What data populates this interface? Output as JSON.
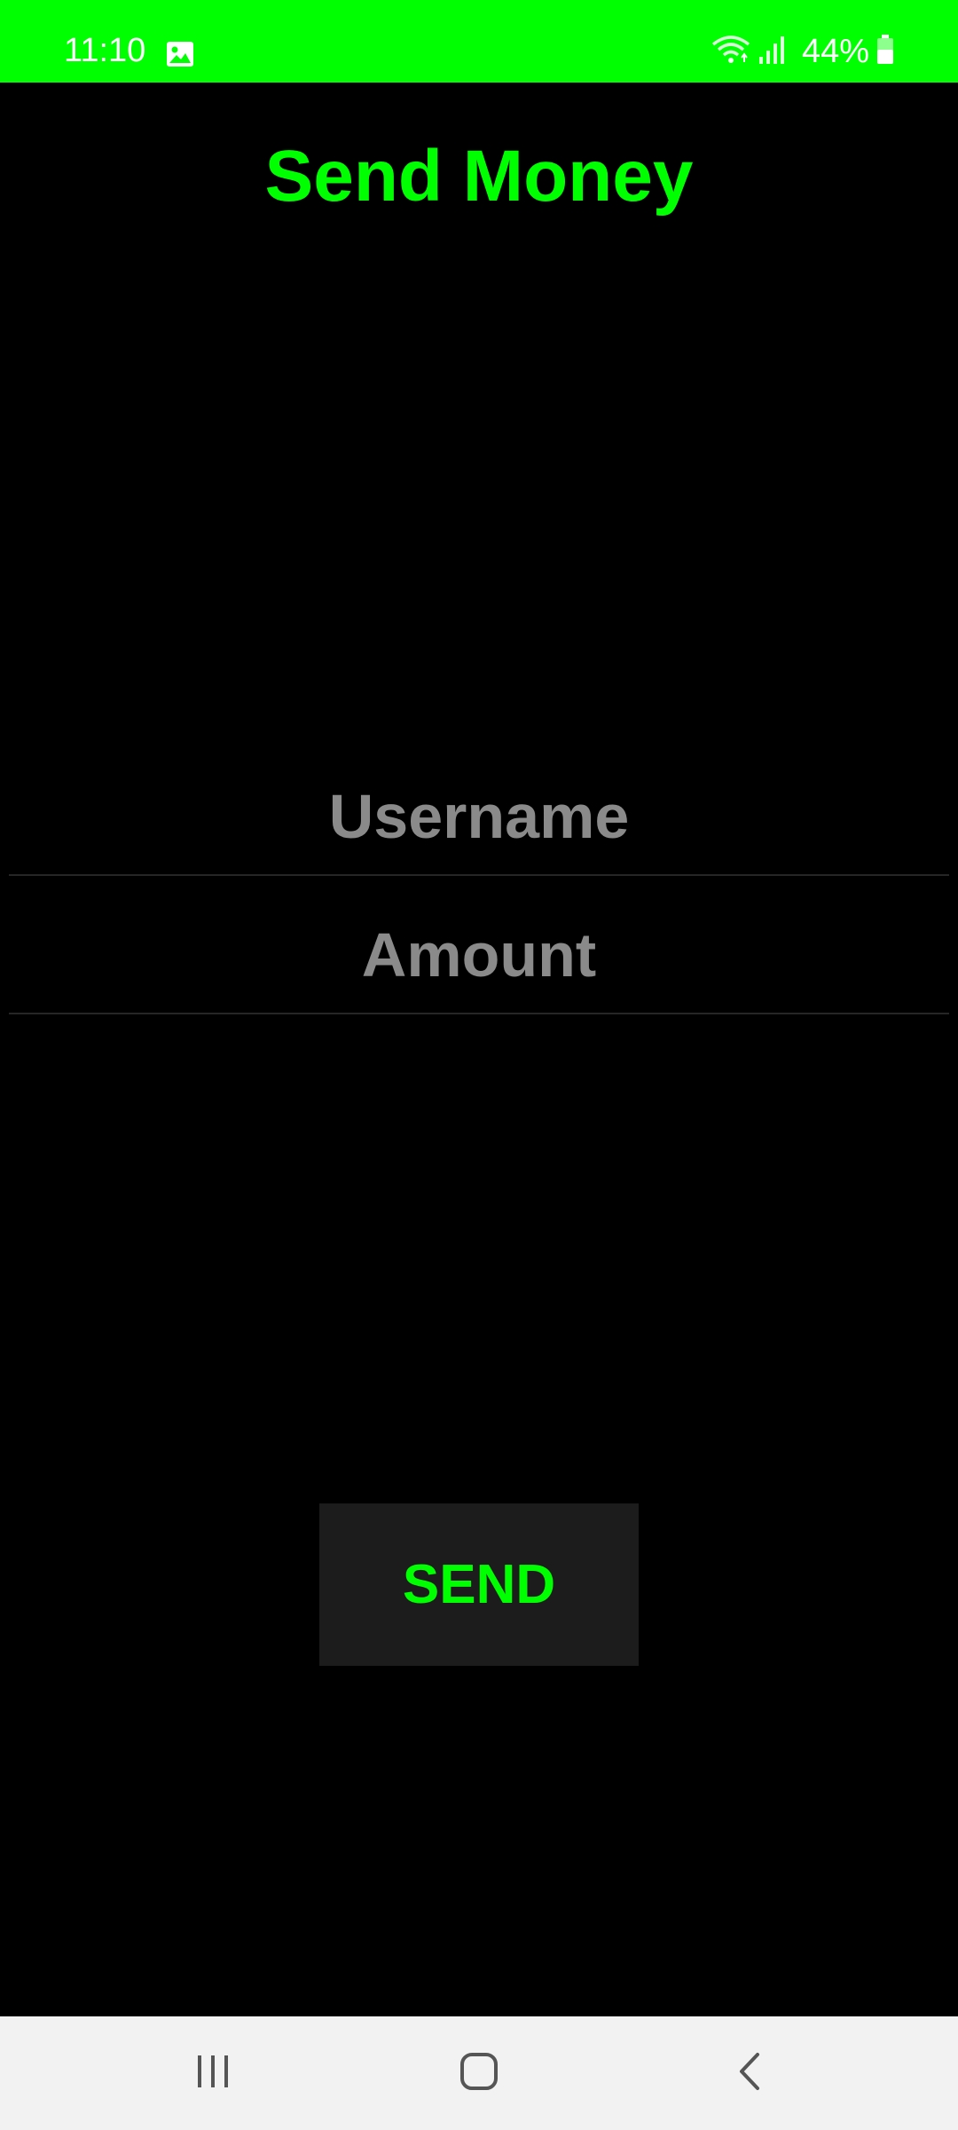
{
  "status_bar": {
    "time": "11:10",
    "battery": "44%",
    "background_color": "#00ff00",
    "icons": [
      "image-icon",
      "wifi-icon",
      "signal-icon",
      "battery-icon"
    ]
  },
  "screen": {
    "title": "Send Money"
  },
  "form": {
    "username_placeholder": "Username",
    "username_value": "",
    "amount_placeholder": "Amount",
    "amount_value": "",
    "send_label": "SEND"
  },
  "nav_bar": {
    "items": [
      "recents-icon",
      "home-icon",
      "back-icon"
    ]
  },
  "colors": {
    "accent": "#00ff00",
    "background": "#000000",
    "placeholder": "#8a8a8a",
    "button_bg": "#1c1c1c",
    "nav_bg": "#f2f2f2"
  }
}
